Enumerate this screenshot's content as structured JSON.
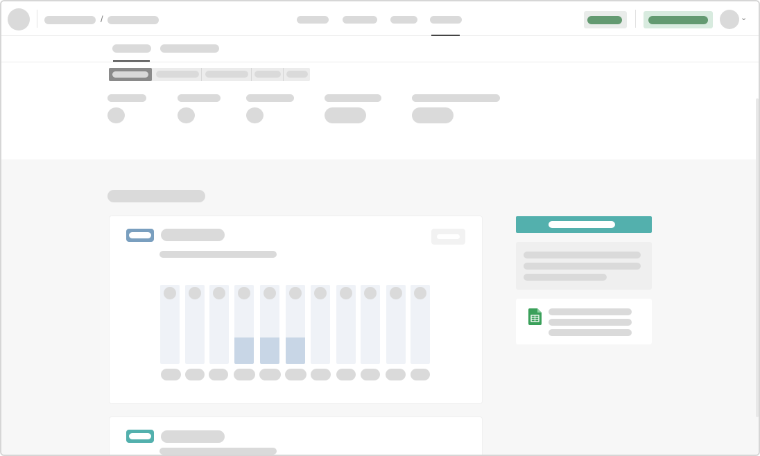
{
  "app": {
    "window_title": "",
    "colors": {
      "accent_green": "#639a71",
      "accent_green_light": "#d8ebdf",
      "teal": "#53b0ad",
      "tag_blue": "#7a9fbf",
      "tag_teal": "#53b0ad",
      "column_fill": "#c8d6e6",
      "skeleton": "#dadada"
    }
  },
  "header": {
    "avatar_icon": "user-avatar-icon",
    "breadcrumb_separator": "/",
    "profile_menu_icon": "chevron-down-icon",
    "profile_chevron_glyph": "⌄"
  },
  "board": {
    "columns": [
      {
        "filled": false
      },
      {
        "filled": false
      },
      {
        "filled": false
      },
      {
        "filled": true
      },
      {
        "filled": true
      },
      {
        "filled": true
      },
      {
        "filled": false
      },
      {
        "filled": false
      },
      {
        "filled": false
      },
      {
        "filled": false
      },
      {
        "filled": false
      }
    ]
  },
  "sidebar": {
    "attachment_icon": "spreadsheet-file-icon"
  }
}
